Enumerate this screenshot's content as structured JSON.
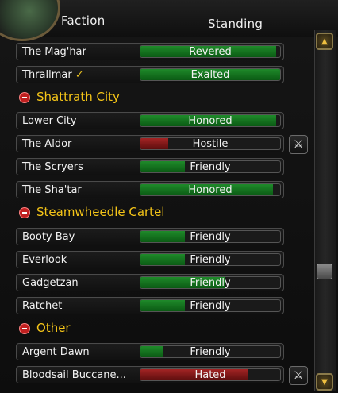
{
  "header": {
    "faction_label": "Faction",
    "standing_label": "Standing"
  },
  "rows": {
    "maghar": {
      "name": "The Mag'har",
      "standing": "Revered",
      "level": 0.97
    },
    "thrallmar": {
      "name": "Thrallmar",
      "standing": "Exalted",
      "level": 1.0
    },
    "lower_city": {
      "name": "Lower City",
      "standing": "Honored",
      "level": 0.97
    },
    "aldor": {
      "name": "The Aldor",
      "standing": "Hostile",
      "level": 0.2
    },
    "scryers": {
      "name": "The Scryers",
      "standing": "Friendly",
      "level": 0.32
    },
    "shatar": {
      "name": "The Sha'tar",
      "standing": "Honored",
      "level": 0.95
    },
    "booty_bay": {
      "name": "Booty Bay",
      "standing": "Friendly",
      "level": 0.32
    },
    "everlook": {
      "name": "Everlook",
      "standing": "Friendly",
      "level": 0.32
    },
    "gadgetzan": {
      "name": "Gadgetzan",
      "standing": "Friendly",
      "level": 0.6
    },
    "ratchet": {
      "name": "Ratchet",
      "standing": "Friendly",
      "level": 0.32
    },
    "argent_dawn": {
      "name": "Argent Dawn",
      "standing": "Friendly",
      "level": 0.16
    },
    "bloodsail": {
      "name": "Bloodsail Buccane...",
      "standing": "Hated",
      "level": 0.77
    }
  },
  "groups": {
    "shattrath": "Shattrath City",
    "steamwheedle": "Steamwheedle Cartel",
    "other": "Other"
  },
  "icons": {
    "checkmark": "checkmark-icon",
    "war": "crossed-swords-icon",
    "collapse": "minus-icon"
  },
  "colors": {
    "friendly_bar": "#1f8a2a",
    "hostile_bar": "#a32424",
    "group_header": "#f5c518"
  }
}
